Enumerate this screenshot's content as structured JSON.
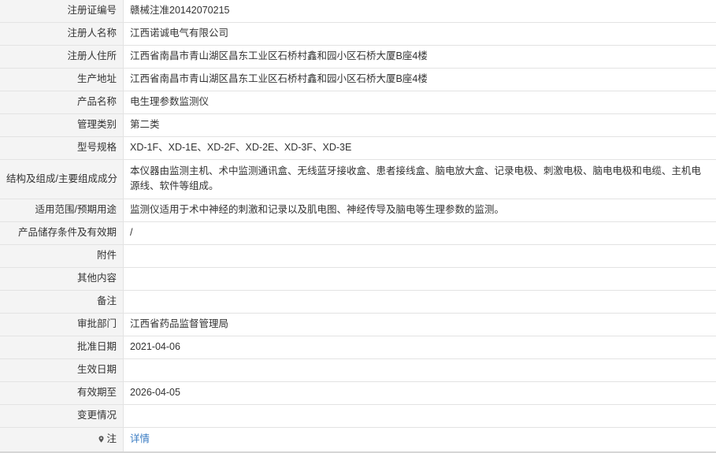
{
  "rows": [
    {
      "label": "注册证编号",
      "value": "赣械注准20142070215"
    },
    {
      "label": "注册人名称",
      "value": "江西诺诚电气有限公司"
    },
    {
      "label": "注册人住所",
      "value": "江西省南昌市青山湖区昌东工业区石桥村鑫和园小区石桥大厦B座4楼"
    },
    {
      "label": "生产地址",
      "value": "江西省南昌市青山湖区昌东工业区石桥村鑫和园小区石桥大厦B座4楼"
    },
    {
      "label": "产品名称",
      "value": "电生理参数监测仪"
    },
    {
      "label": "管理类别",
      "value": "第二类"
    },
    {
      "label": "型号规格",
      "value": "XD-1F、XD-1E、XD-2F、XD-2E、XD-3F、XD-3E"
    },
    {
      "label": "结构及组成/主要组成成分",
      "value": "本仪器由监测主机、术中监测通讯盒、无线蓝牙接收盒、患者接线盒、脑电放大盒、记录电极、刺激电极、脑电电极和电缆、主机电源线、软件等组成。"
    },
    {
      "label": "适用范围/预期用途",
      "value": "监测仪适用于术中神经的刺激和记录以及肌电图、神经传导及脑电等生理参数的监测。"
    },
    {
      "label": "产品储存条件及有效期",
      "value": "/"
    },
    {
      "label": "附件",
      "value": ""
    },
    {
      "label": "其他内容",
      "value": ""
    },
    {
      "label": "备注",
      "value": ""
    },
    {
      "label": "审批部门",
      "value": "江西省药品监督管理局"
    },
    {
      "label": "批准日期",
      "value": "2021-04-06"
    },
    {
      "label": "生效日期",
      "value": ""
    },
    {
      "label": "有效期至",
      "value": "2026-04-05"
    },
    {
      "label": "变更情况",
      "value": ""
    }
  ],
  "note": {
    "label": "注",
    "link_text": "详情",
    "icon": "location-pin-icon"
  }
}
